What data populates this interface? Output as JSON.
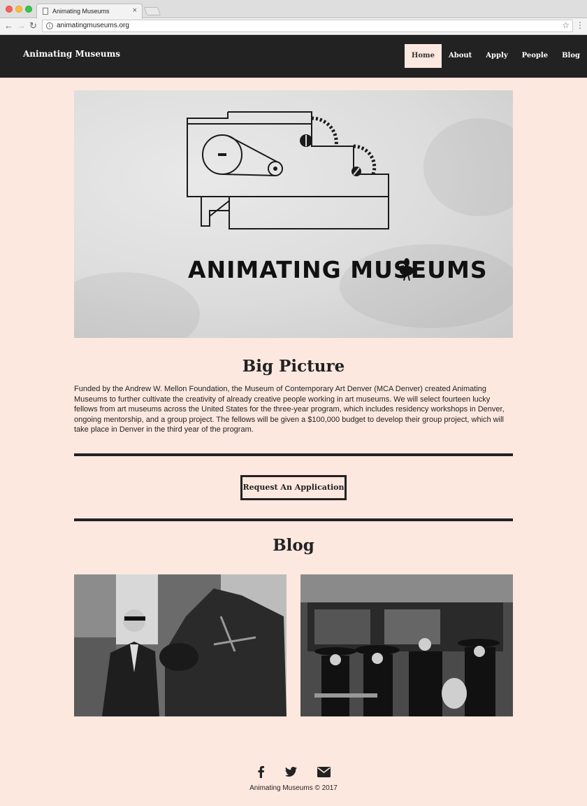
{
  "browser": {
    "tab_title": "Animating Museums",
    "tab_close": "×",
    "url": "animatingmuseums.org"
  },
  "site": {
    "brand": "Animating Museums",
    "nav": [
      "Home",
      "About",
      "Apply",
      "People",
      "Blog"
    ],
    "active_nav": "Home"
  },
  "hero": {
    "logo_text": "ANIMATING MUSEUMS"
  },
  "big_picture": {
    "title": "Big Picture",
    "body": "Funded by the Andrew W. Mellon Foundation, the Museum of Contemporary Art Denver (MCA Denver) created Animating Museums to further cultivate the creativity of already creative people working in art museums. We will select fourteen lucky fellows from art museums across the United States for the three-year program, which includes residency workshops in Denver, ongoing mentorship, and a group project. The fellows will be given a $100,000 budget to develop their group project, which will take place in Denver in the third year of the program."
  },
  "cta": {
    "label": "Request An Application"
  },
  "blog": {
    "title": "Blog"
  },
  "footer": {
    "icons": [
      "facebook-icon",
      "twitter-icon",
      "envelope-icon"
    ],
    "copyright": "Animating Museums © 2017"
  },
  "colors": {
    "page_bg": "#fde8e0",
    "header_bg": "#222222",
    "text": "#222222"
  }
}
